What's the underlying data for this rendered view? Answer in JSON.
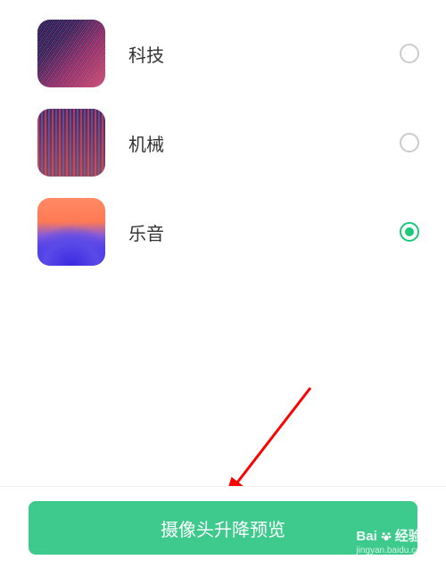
{
  "options": [
    {
      "id": "tech",
      "label": "科技",
      "selected": false
    },
    {
      "id": "mechanical",
      "label": "机械",
      "selected": false
    },
    {
      "id": "sound",
      "label": "乐音",
      "selected": true
    }
  ],
  "preview_button": "摄像头升降预览",
  "watermark": {
    "brand": "Bai",
    "brand_suffix": "经验",
    "url": "jingyan.baidu.com"
  }
}
